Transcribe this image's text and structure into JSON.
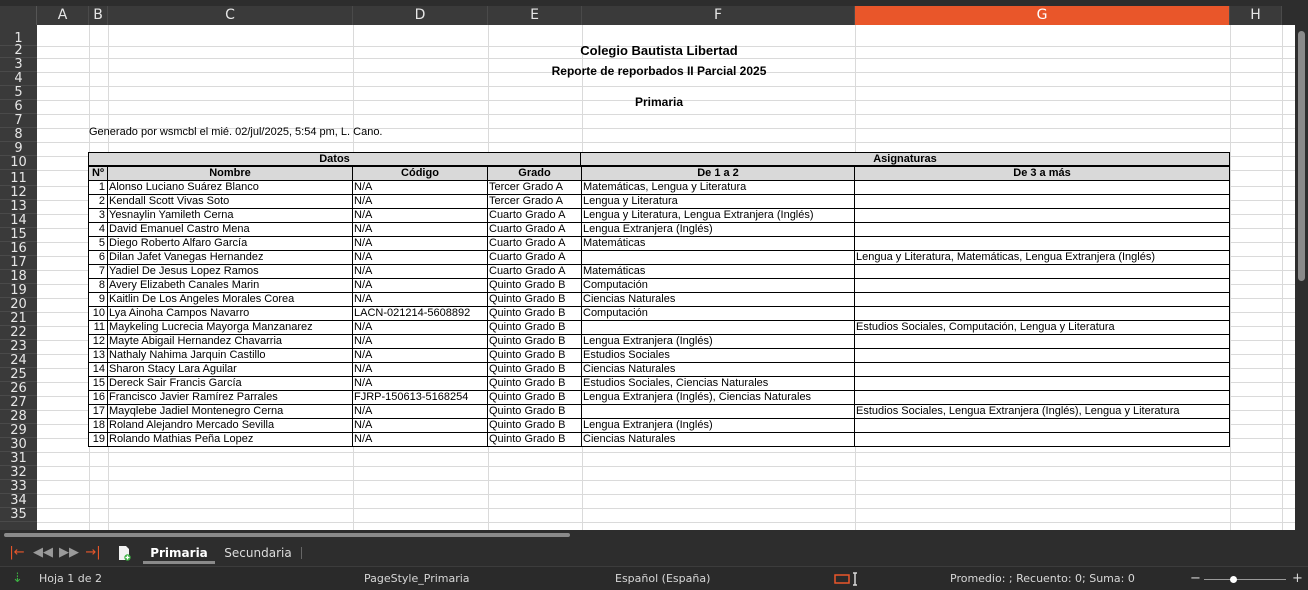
{
  "columns": [
    {
      "id": "A",
      "selected": false
    },
    {
      "id": "B",
      "selected": false
    },
    {
      "id": "C",
      "selected": false
    },
    {
      "id": "D",
      "selected": false
    },
    {
      "id": "E",
      "selected": false
    },
    {
      "id": "F",
      "selected": false
    },
    {
      "id": "G",
      "selected": true
    },
    {
      "id": "H",
      "selected": false
    }
  ],
  "rows": [
    "1",
    "2",
    "3",
    "4",
    "5",
    "6",
    "7",
    "8",
    "9",
    "10",
    "11",
    "12",
    "13",
    "14",
    "15",
    "16",
    "17",
    "18",
    "19",
    "20",
    "21",
    "22",
    "23",
    "24",
    "25",
    "26",
    "27",
    "28",
    "29",
    "30",
    "31",
    "32",
    "33",
    "34",
    "35"
  ],
  "sheet": {
    "title": "Colegio Bautista Libertad",
    "subtitle": "Reporte de reporbados II Parcial 2025",
    "section": "Primaria",
    "generated": "Generado por wsmcbl el mié. 02/jul/2025, 5:54 pm, L. Cano.",
    "group_headers": {
      "datos": "Datos",
      "asignaturas": "Asignaturas"
    },
    "col_headers": {
      "num": "Nº",
      "nombre": "Nombre",
      "codigo": "Código",
      "grado": "Grado",
      "de1a2": "De 1 a 2",
      "de3mas": "De 3 a más"
    },
    "records": [
      {
        "num": "1",
        "nombre": "Alonso Luciano Suárez Blanco",
        "codigo": "N/A",
        "grado": "Tercer Grado A",
        "de1a2": "Matemáticas, Lengua y Literatura",
        "de3mas": ""
      },
      {
        "num": "2",
        "nombre": "Kendall Scott Vivas Soto",
        "codigo": "N/A",
        "grado": "Tercer Grado A",
        "de1a2": "Lengua y Literatura",
        "de3mas": ""
      },
      {
        "num": "3",
        "nombre": "Yesnaylin Yamileth Cerna",
        "codigo": "N/A",
        "grado": "Cuarto Grado A",
        "de1a2": "Lengua y Literatura, Lengua Extranjera (Inglés)",
        "de3mas": ""
      },
      {
        "num": "4",
        "nombre": "David Emanuel Castro Mena",
        "codigo": "N/A",
        "grado": "Cuarto Grado A",
        "de1a2": "Lengua Extranjera (Inglés)",
        "de3mas": ""
      },
      {
        "num": "5",
        "nombre": "Diego Roberto Alfaro García",
        "codigo": "N/A",
        "grado": "Cuarto Grado A",
        "de1a2": "Matemáticas",
        "de3mas": ""
      },
      {
        "num": "6",
        "nombre": "Dilan Jafet Vanegas Hernandez",
        "codigo": "N/A",
        "grado": "Cuarto Grado A",
        "de1a2": "",
        "de3mas": "Lengua y Literatura, Matemáticas, Lengua Extranjera (Inglés)"
      },
      {
        "num": "7",
        "nombre": "Yadiel De Jesus Lopez Ramos",
        "codigo": "N/A",
        "grado": "Cuarto Grado A",
        "de1a2": "Matemáticas",
        "de3mas": ""
      },
      {
        "num": "8",
        "nombre": "Avery Elizabeth Canales Marin",
        "codigo": "N/A",
        "grado": "Quinto Grado B",
        "de1a2": "Computación",
        "de3mas": ""
      },
      {
        "num": "9",
        "nombre": "Kaitlin De Los Angeles Morales Corea",
        "codigo": "N/A",
        "grado": "Quinto Grado B",
        "de1a2": "Ciencias Naturales",
        "de3mas": ""
      },
      {
        "num": "10",
        "nombre": "Lya Ainoha Campos Navarro",
        "codigo": "LACN-021214-5608892",
        "grado": "Quinto Grado B",
        "de1a2": "Computación",
        "de3mas": ""
      },
      {
        "num": "11",
        "nombre": "Maykeling Lucrecia Mayorga Manzanarez",
        "codigo": "N/A",
        "grado": "Quinto Grado B",
        "de1a2": "",
        "de3mas": "Estudios Sociales, Computación, Lengua y Literatura"
      },
      {
        "num": "12",
        "nombre": "Mayte Abigail Hernandez Chavarria",
        "codigo": "N/A",
        "grado": "Quinto Grado B",
        "de1a2": "Lengua Extranjera (Inglés)",
        "de3mas": ""
      },
      {
        "num": "13",
        "nombre": "Nathaly Nahima Jarquin Castillo",
        "codigo": "N/A",
        "grado": "Quinto Grado B",
        "de1a2": "Estudios Sociales",
        "de3mas": ""
      },
      {
        "num": "14",
        "nombre": "Sharon Stacy Lara Aguilar",
        "codigo": "N/A",
        "grado": "Quinto Grado B",
        "de1a2": "Ciencias Naturales",
        "de3mas": ""
      },
      {
        "num": "15",
        "nombre": "Dereck Sair Francis García",
        "codigo": "N/A",
        "grado": "Quinto Grado B",
        "de1a2": "Estudios Sociales, Ciencias Naturales",
        "de3mas": ""
      },
      {
        "num": "16",
        "nombre": "Francisco Javier Ramírez Parrales",
        "codigo": "FJRP-150613-5168254",
        "grado": "Quinto Grado B",
        "de1a2": "Lengua Extranjera (Inglés), Ciencias Naturales",
        "de3mas": ""
      },
      {
        "num": "17",
        "nombre": "Mayqlebe Jadiel Montenegro Cerna",
        "codigo": "N/A",
        "grado": "Quinto Grado B",
        "de1a2": "",
        "de3mas": "Estudios Sociales, Lengua Extranjera (Inglés), Lengua y Literatura"
      },
      {
        "num": "18",
        "nombre": "Roland Alejandro Mercado Sevilla",
        "codigo": "N/A",
        "grado": "Quinto Grado B",
        "de1a2": "Lengua Extranjera (Inglés)",
        "de3mas": ""
      },
      {
        "num": "19",
        "nombre": "Rolando Mathias Peña Lopez",
        "codigo": "N/A",
        "grado": "Quinto Grado B",
        "de1a2": "Ciencias Naturales",
        "de3mas": ""
      }
    ]
  },
  "tabs": [
    {
      "label": "Primaria",
      "active": true
    },
    {
      "label": "Secundaria",
      "active": false
    }
  ],
  "status": {
    "sheet_position": "Hoja 1 de 2",
    "page_style": "PageStyle_Primaria",
    "language": "Español (España)",
    "summary": "Promedio: ; Recuento: 0; Suma: 0"
  },
  "colors": {
    "selected_column": "#e9562a",
    "chrome": "#2d2d2d",
    "nav_red": "#e9562a"
  }
}
